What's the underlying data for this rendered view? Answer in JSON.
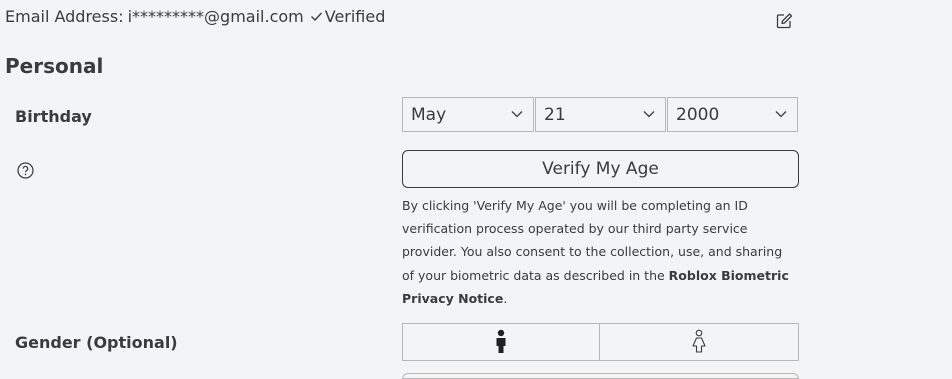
{
  "account": {
    "email_label": "Email Address:",
    "email_value": "i*********@gmail.com",
    "email_status": "Verified",
    "check_icon": "checkmark-icon",
    "edit_icon": "edit-pencil-icon"
  },
  "personal": {
    "section_title": "Personal",
    "birthday": {
      "label": "Birthday",
      "month": "May",
      "day": "21",
      "year": "2000"
    },
    "help_icon": "question-circle-icon",
    "verify_button_label": "Verify My Age",
    "disclaimer": {
      "text": "By clicking 'Verify My Age' you will be completing an ID verification process operated by our third party service provider. You also consent to the collection, use, and sharing of your biometric data as described in the ",
      "link_text": "Roblox Biometric Privacy Notice",
      "end": "."
    },
    "gender": {
      "label": "Gender (Optional)",
      "male_icon": "male-figure-icon",
      "female_icon": "female-figure-icon"
    }
  }
}
